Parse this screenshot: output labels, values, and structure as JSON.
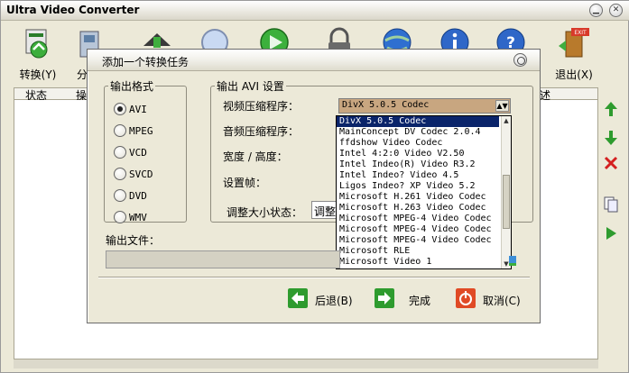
{
  "app": {
    "title": "Ultra Video Converter"
  },
  "toolbar": {
    "convert_label": "转换(Y)",
    "split_label_partial": "分",
    "exit_label": "退出(X)",
    "exit_sign": "EXIT"
  },
  "grid": {
    "columns": [
      "状态",
      "操",
      "述"
    ]
  },
  "dialog": {
    "title": "添加一个转换任务",
    "format_group": {
      "legend": "输出格式",
      "options": [
        "AVI",
        "MPEG",
        "VCD",
        "SVCD",
        "DVD",
        "WMV"
      ],
      "selected": "AVI"
    },
    "settings_group": {
      "legend": "输出 AVI 设置",
      "video_codec_label": "视频压缩程序：",
      "audio_codec_label": "音频压缩程序：",
      "size_label": "宽度 / 高度：",
      "fps_label": "设置帧：",
      "resize_label": "调整大小状态：",
      "resize_value": "调整"
    },
    "video_codec": {
      "selected": "DivX 5.0.5 Codec",
      "options": [
        "DivX 5.0.5 Codec",
        "MainConcept DV Codec 2.0.4",
        "ffdshow Video Codec",
        "Intel 4:2:0 Video V2.50",
        "Intel Indeo(R) Video R3.2",
        "Intel Indeo? Video 4.5",
        "Ligos Indeo? XP Video 5.2",
        "Microsoft H.261 Video Codec",
        "Microsoft H.263 Video Codec",
        "Microsoft MPEG-4 Video Codec",
        "Microsoft MPEG-4 Video Codec",
        "Microsoft MPEG-4 Video Codec",
        "Microsoft RLE",
        "Microsoft Video 1"
      ]
    },
    "output_file_label": "输出文件：",
    "output_file_value": "",
    "buttons": {
      "back": "后退(B)",
      "finish": "完成",
      "cancel": "取消(C)"
    }
  },
  "colors": {
    "window_bg": "#ece9d8",
    "selection": "#0a246a",
    "combo_bg": "#c8a680",
    "green": "#2e9b2e",
    "red": "#d42020"
  }
}
